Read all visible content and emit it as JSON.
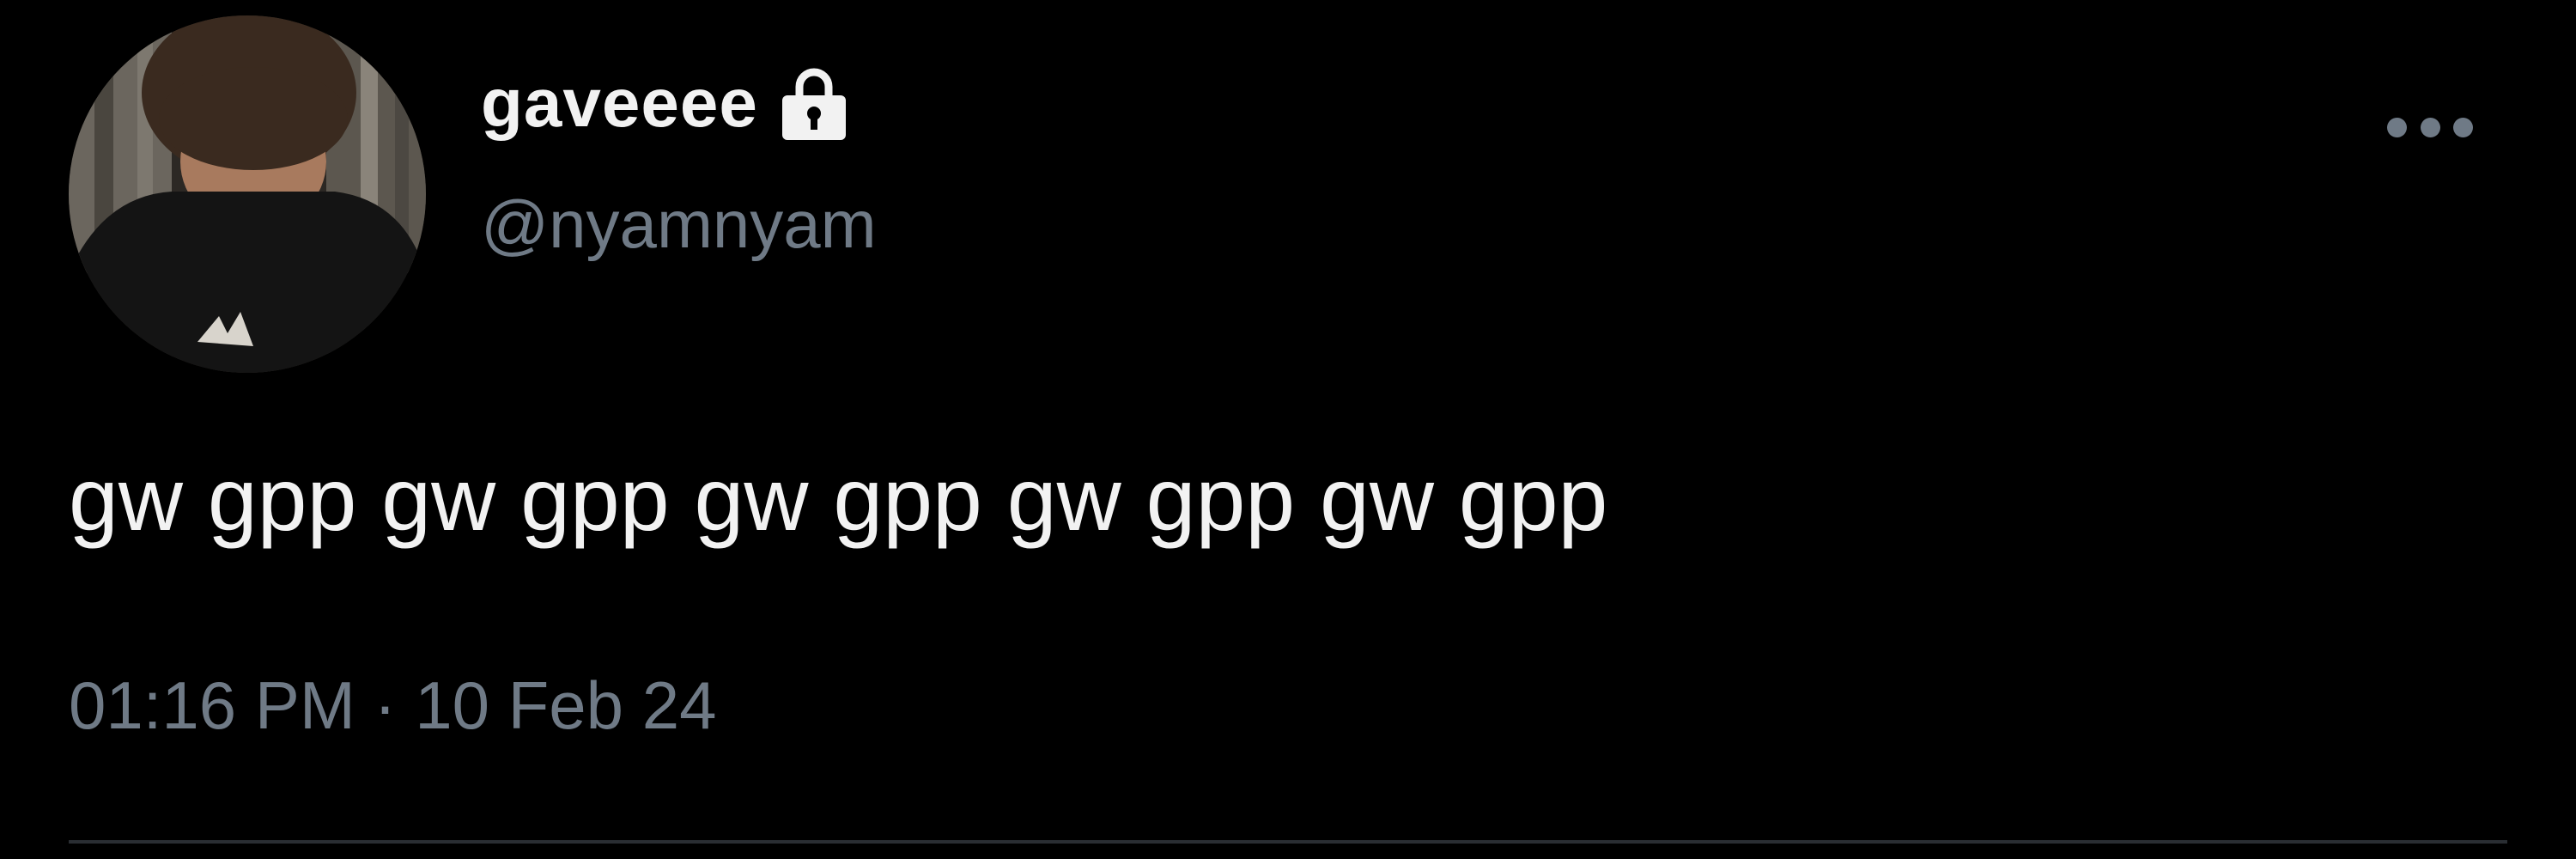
{
  "tweet": {
    "display_name": "gaveeee",
    "handle": "@nyamnyam",
    "text": "gw gpp gw gpp gw gpp gw gpp gw gpp",
    "time": "01:16 PM",
    "separator": "·",
    "date": "10 Feb 24",
    "account_status_icon": "lock-icon",
    "menu_icon": "more-options-icon"
  },
  "colors": {
    "background": "#000000",
    "primary_text": "#f2f2f2",
    "secondary_text": "#6f7a86",
    "divider": "#2a2e33"
  }
}
